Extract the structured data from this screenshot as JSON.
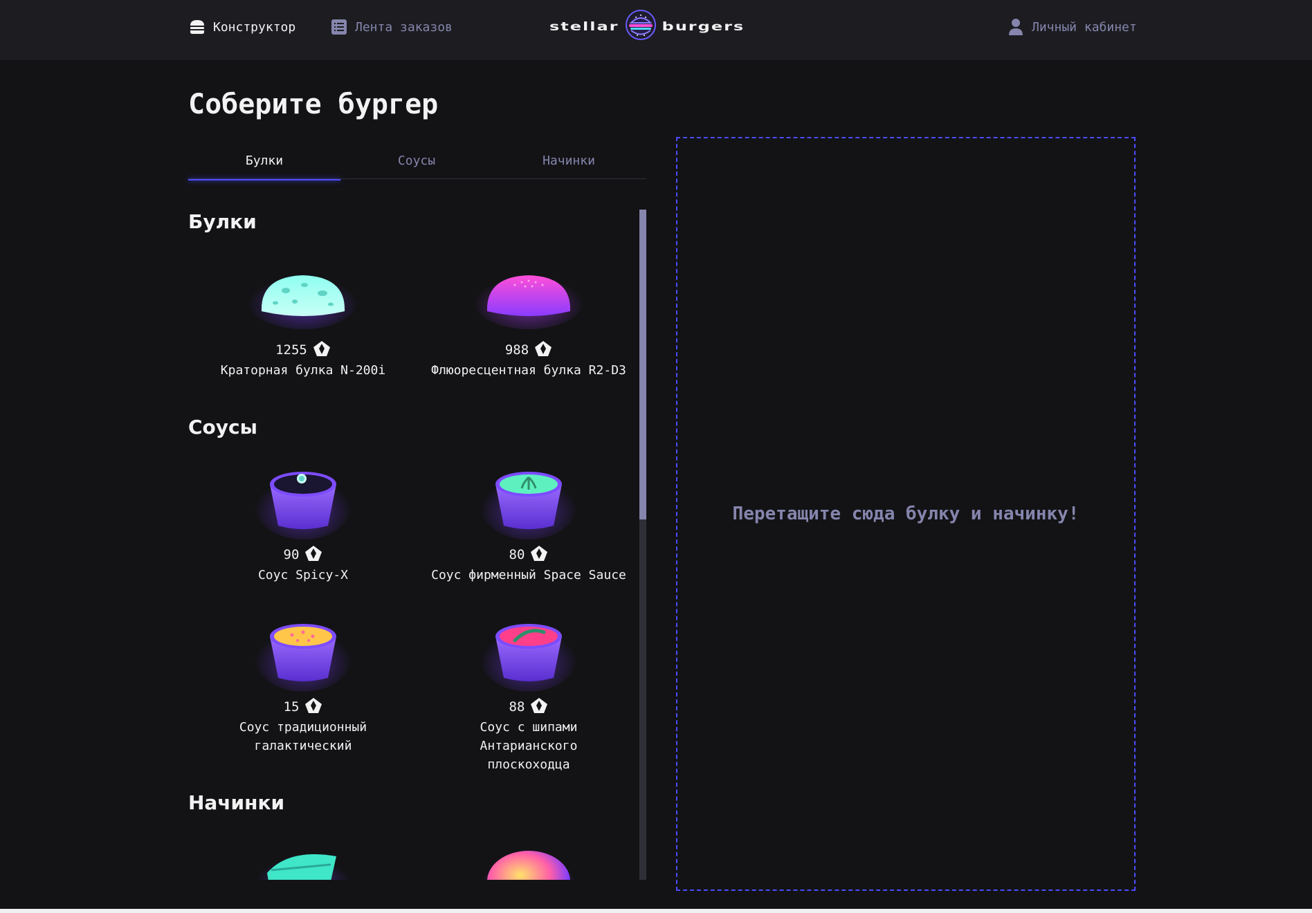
{
  "header": {
    "nav": {
      "constructor": "Конструктор",
      "feed": "Лента заказов",
      "profile": "Личный кабинет"
    },
    "logo": {
      "left": "stellar",
      "right": "burgers"
    }
  },
  "main": {
    "title": "Соберите бургер",
    "tabs": [
      {
        "label": "Булки",
        "active": true
      },
      {
        "label": "Соусы",
        "active": false
      },
      {
        "label": "Начинки",
        "active": false
      }
    ],
    "sections": {
      "buns": {
        "title": "Булки",
        "items": [
          {
            "price": "1255",
            "name": "Краторная булка N-200i",
            "image": "crater-bun"
          },
          {
            "price": "988",
            "name": "Флюоресцентная булка R2-D3",
            "image": "fluorescent-bun"
          }
        ]
      },
      "sauces": {
        "title": "Соусы",
        "items": [
          {
            "price": "90",
            "name": "Соус Spicy-X",
            "image": "sauce-dark"
          },
          {
            "price": "80",
            "name": "Соус фирменный Space Sauce",
            "image": "sauce-green"
          },
          {
            "price": "15",
            "name_line1": "Соус традиционный",
            "name_line2": "галактический",
            "image": "sauce-yellow"
          },
          {
            "price": "88",
            "name_line1": "Соус с шипами Антарианского",
            "name_line2": "плоскоходца",
            "image": "sauce-pink"
          }
        ]
      },
      "fillings": {
        "title": "Начинки"
      }
    }
  },
  "constructor": {
    "empty_text": "Перетащите сюда булку и начинку!"
  },
  "colors": {
    "background": "#131316",
    "header": "#1c1c21",
    "accent": "#4c4cff",
    "inactive_text": "#8585ad"
  }
}
